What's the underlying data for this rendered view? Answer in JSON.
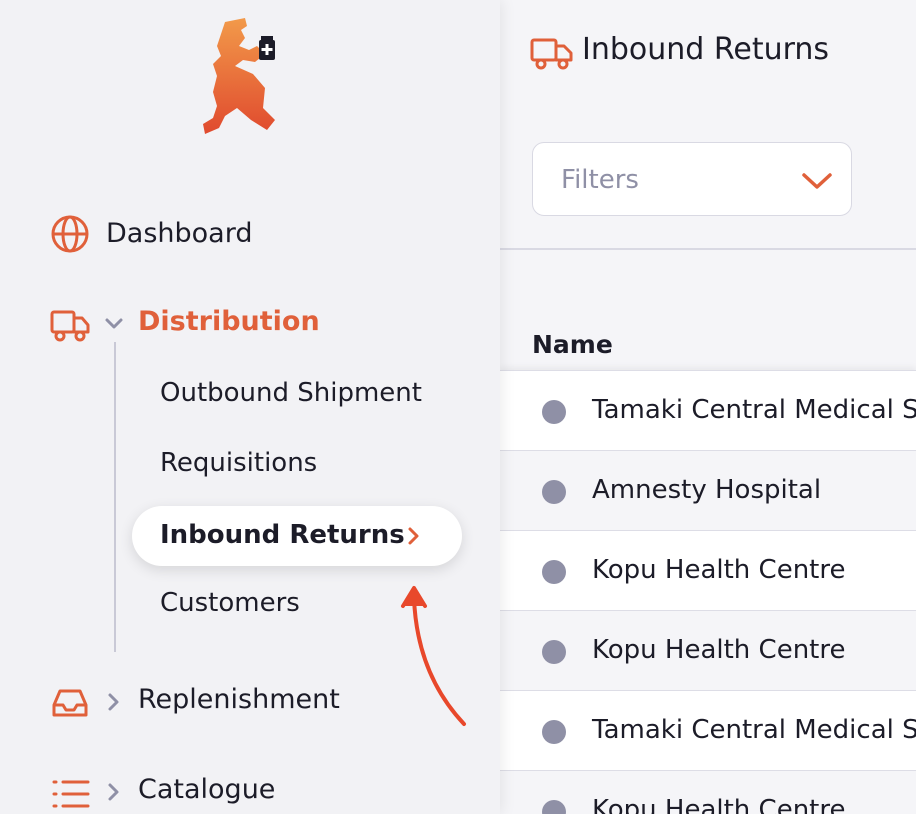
{
  "sidebar": {
    "items": [
      {
        "label": "Dashboard",
        "icon": "globe-icon"
      },
      {
        "label": "Distribution",
        "icon": "truck-icon",
        "expanded": true
      },
      {
        "label": "Replenishment",
        "icon": "inbox-icon"
      },
      {
        "label": "Catalogue",
        "icon": "list-icon"
      }
    ],
    "distribution_children": [
      {
        "label": "Outbound Shipment"
      },
      {
        "label": "Requisitions"
      },
      {
        "label": "Inbound Returns",
        "active": true
      },
      {
        "label": "Customers"
      }
    ]
  },
  "main": {
    "title": "Inbound Returns",
    "filter_label": "Filters",
    "columns": [
      "Name"
    ],
    "rows": [
      {
        "name": "Tamaki Central Medical S"
      },
      {
        "name": "Amnesty Hospital"
      },
      {
        "name": "Kopu Health Centre"
      },
      {
        "name": "Kopu Health Centre"
      },
      {
        "name": "Tamaki Central Medical S"
      },
      {
        "name": "Kopu Health Centre"
      }
    ]
  },
  "colors": {
    "accent": "#e0603a",
    "status_dot": "#8f90a6",
    "annotation": "#e8482b"
  }
}
